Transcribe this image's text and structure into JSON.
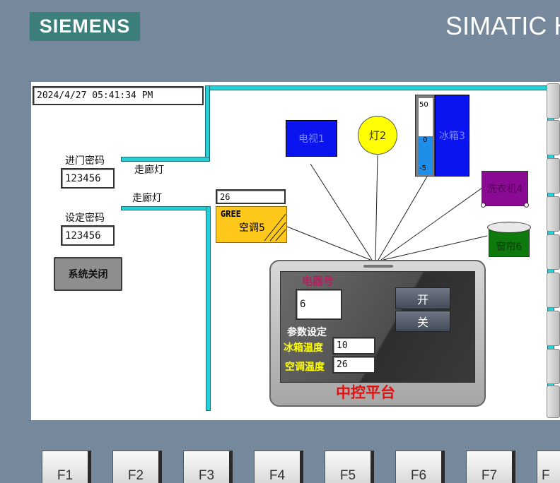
{
  "header": {
    "logo": "SIEMENS",
    "brand": "SIMATIC H"
  },
  "screen": {
    "datetime": "2024/4/27 05:41:34 PM",
    "door_password_label": "进门密码",
    "door_password_value": "123456",
    "set_password_label": "设定密码",
    "set_password_value": "123456",
    "corridor_light_1": "走廊灯",
    "corridor_light_2": "走廊灯",
    "shutdown_button": "系统关闭",
    "ac_temp_display": "26",
    "devices": {
      "tv": "电视1",
      "light": "灯2",
      "fridge": "冰箱3",
      "fridge_scale": [
        "50",
        "0",
        "-5"
      ],
      "fridge_level_percent": 50,
      "washer": "洗衣机4",
      "ac_brand": "GREE",
      "ac": "空调5",
      "curtain": "窗帘6"
    },
    "control": {
      "device_no_label": "电器号",
      "device_no_value": "6",
      "on_button": "开",
      "off_button": "关",
      "params_label": "参数设定",
      "fridge_temp_label": "冰箱温度",
      "fridge_temp_value": "10",
      "ac_temp_label": "空调温度",
      "ac_temp_value": "26",
      "title": "中控平台"
    }
  },
  "function_keys": [
    "F1",
    "F2",
    "F3",
    "F4",
    "F5",
    "F6",
    "F7",
    "F"
  ],
  "colors": {
    "accent_pipe": "#26d0d8",
    "logo_bg": "#3b7e7a",
    "title_red": "#e01010",
    "label_yellow": "#ffff00"
  }
}
